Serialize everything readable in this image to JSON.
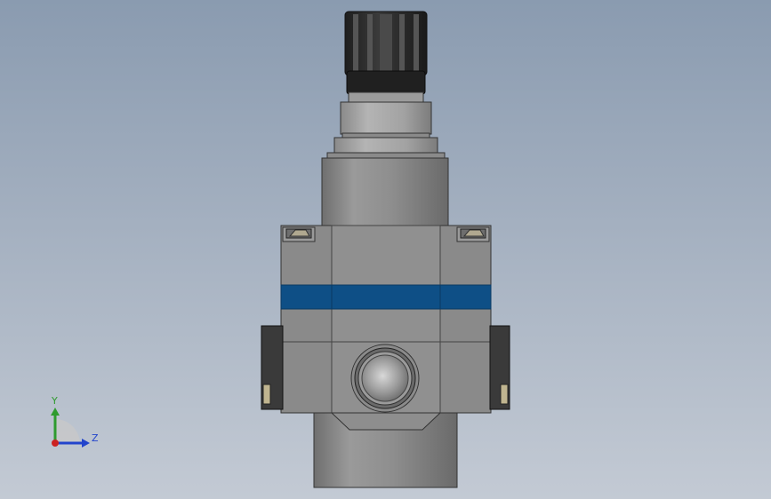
{
  "viewport": {
    "background_top": "#8a9bb0",
    "background_bottom": "#c3cad4"
  },
  "model": {
    "body_color": "#8c8c8c",
    "band_color": "#0e4f86",
    "knob_color": "#2a2a2a"
  },
  "triad": {
    "y_label": "Y",
    "z_label": "Z",
    "y_color": "#2e9b2e",
    "z_color": "#2244cc",
    "x_color": "#cc2222"
  }
}
